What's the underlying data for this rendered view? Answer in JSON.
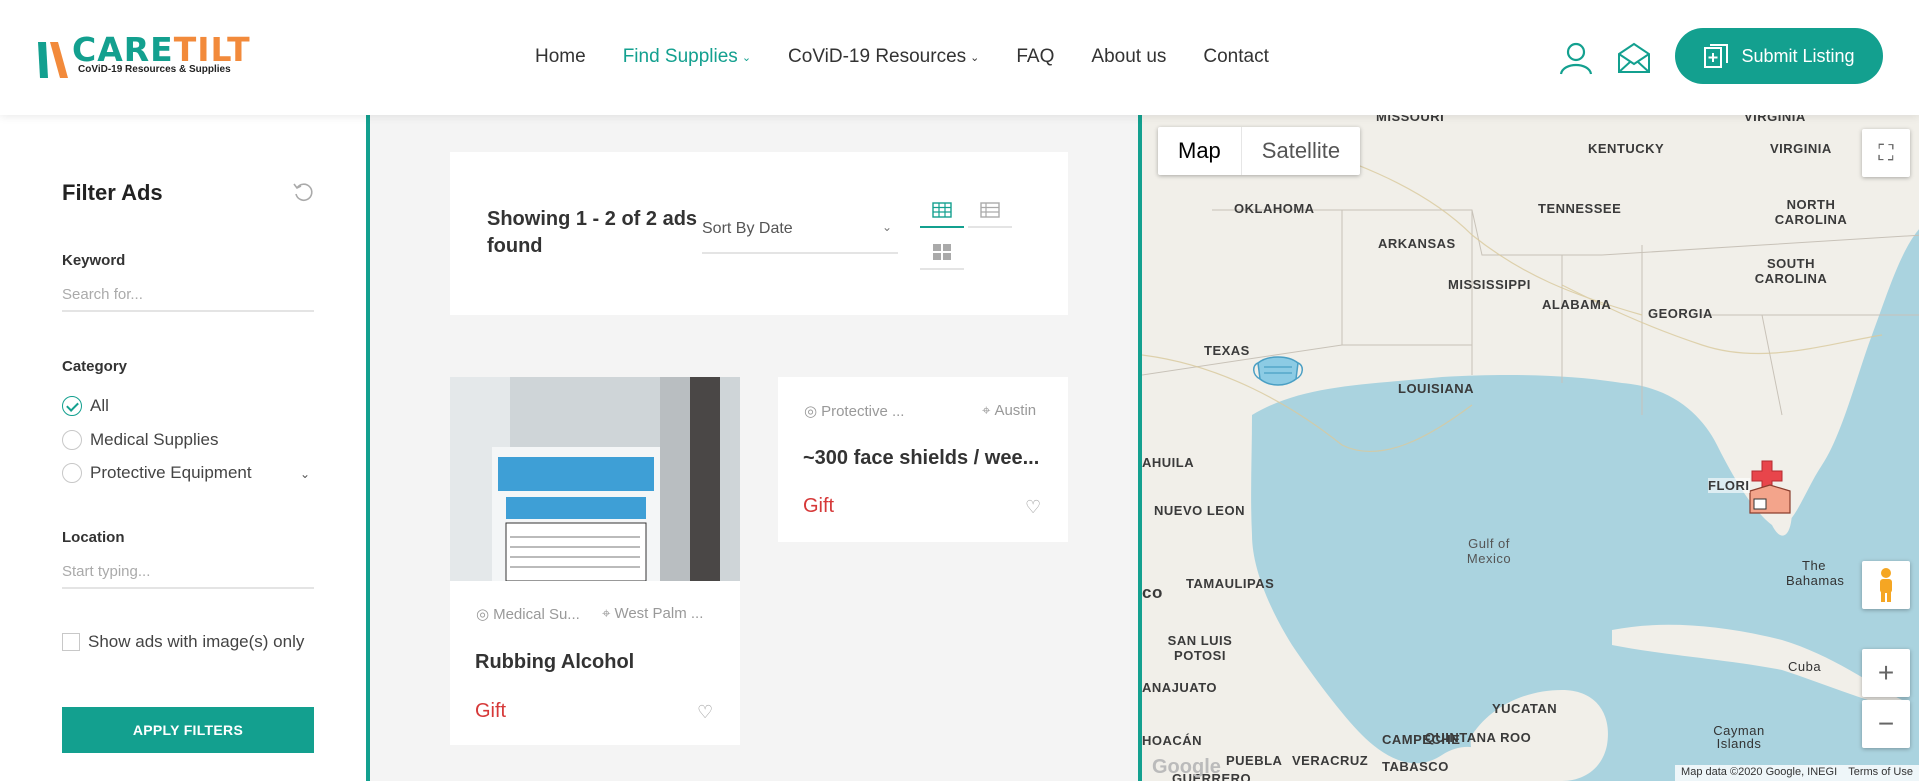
{
  "brand": {
    "name_part1": "CARE",
    "name_part2": "TILT",
    "tagline": "CoViD-19 Resources & Supplies",
    "colors": {
      "primary": "#13a08f",
      "accent": "#f28a3b",
      "price": "#d63838"
    }
  },
  "nav": {
    "items": [
      {
        "label": "Home",
        "active": false,
        "dropdown": false
      },
      {
        "label": "Find Supplies",
        "active": true,
        "dropdown": true
      },
      {
        "label": "CoViD-19 Resources",
        "active": false,
        "dropdown": true
      },
      {
        "label": "FAQ",
        "active": false,
        "dropdown": false
      },
      {
        "label": "About us",
        "active": false,
        "dropdown": false
      },
      {
        "label": "Contact",
        "active": false,
        "dropdown": false
      }
    ],
    "user_icon": "user-icon",
    "mail_icon": "mail-icon",
    "submit_label": "Submit Listing"
  },
  "filter": {
    "title": "Filter Ads",
    "keyword_label": "Keyword",
    "keyword_placeholder": "Search for...",
    "category_label": "Category",
    "categories": [
      {
        "label": "All",
        "checked": true
      },
      {
        "label": "Medical Supplies",
        "checked": false
      },
      {
        "label": "Protective Equipment",
        "checked": false
      }
    ],
    "location_label": "Location",
    "location_placeholder": "Start typing...",
    "images_only_label": "Show ads with image(s) only",
    "apply_label": "APPLY FILTERS"
  },
  "listing": {
    "showing_text": "Showing 1 - 2 of 2 ads found",
    "sort_value": "Sort By Date",
    "ads": [
      {
        "category": "Medical Su...",
        "location": "West Palm ...",
        "title": "Rubbing Alcohol",
        "price": "Gift",
        "image_text": "70% Alcohol",
        "image_subtext": "Isopropyl Rubbing Alcohol"
      },
      {
        "category": "Protective ...",
        "location": "Austin",
        "title": "~300 face shields / wee...",
        "price": "Gift"
      }
    ]
  },
  "map": {
    "tab_map": "Map",
    "tab_satellite": "Satellite",
    "labels": {
      "missouri": "MISSOURI",
      "virginia_top": "VIRGINIA",
      "kentucky": "KENTUCKY",
      "virginia": "VIRGINIA",
      "oklahoma": "OKLAHOMA",
      "tennessee": "TENNESSEE",
      "north_carolina": "NORTH CAROLINA",
      "arkansas": "ARKANSAS",
      "south_carolina": "SOUTH CAROLINA",
      "mississippi": "MISSISSIPPI",
      "alabama": "ALABAMA",
      "georgia": "GEORGIA",
      "texas": "TEXAS",
      "louisiana": "LOUISIANA",
      "coahuila": "AHUILA",
      "florida": "FLORI",
      "nuevo_leon": "NUEVO LEON",
      "gulf": "Gulf of Mexico",
      "tamaulipas": "TAMAULIPAS",
      "the_bahamas": "The Bahamas",
      "mexico_part": "co",
      "san_luis": "SAN LUIS POTOSI",
      "cuba": "Cuba",
      "guanajuato": "ANAJUATO",
      "yucatan": "YUCATAN",
      "michoacan": "HOACÁN",
      "puebla": "PUEBLA",
      "veracruz": "VERACRUZ",
      "campeche": "CAMPECHE",
      "quintana_roo": "QUINTANA ROO",
      "cayman": "Cayman Islands",
      "tabasco": "TABASCO",
      "guerrero": "GUERRERO"
    },
    "attribution": "Map data ©2020 Google, INEGI",
    "terms": "Terms of Use",
    "google": "Google"
  }
}
